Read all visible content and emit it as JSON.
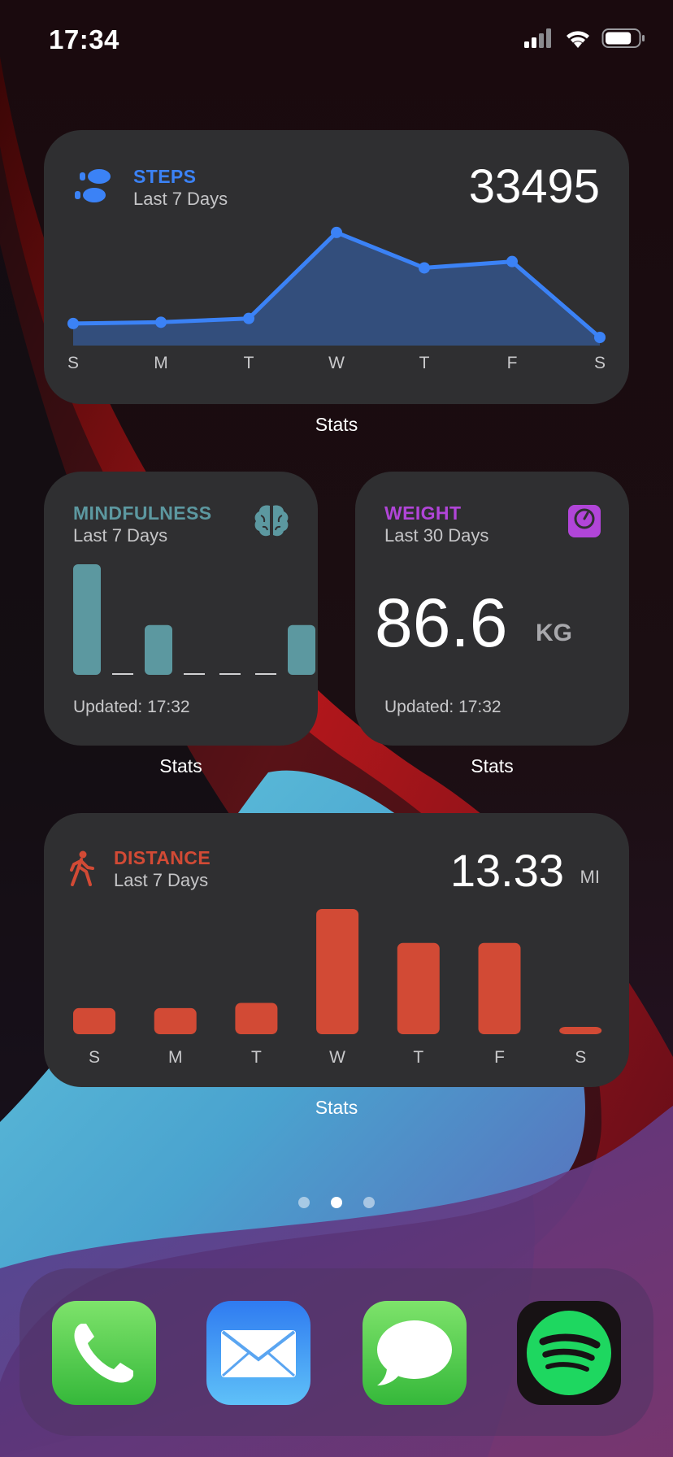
{
  "status_bar": {
    "time": "17:34",
    "battery_level": 0.8,
    "signal_bars": 2,
    "signal_bars_total": 4
  },
  "colors": {
    "steps": "#3b82f6",
    "mindfulness": "#5c98a0",
    "weight": "#b145d8",
    "distance": "#d24a35",
    "widget_bg": "#2f2f31"
  },
  "steps_widget": {
    "title": "STEPS",
    "subtitle": "Last 7 Days",
    "total": "33495",
    "icon": "footprints-icon",
    "label": "Stats",
    "chart_data": {
      "type": "area",
      "categories": [
        "S",
        "M",
        "T",
        "W",
        "T",
        "F",
        "S"
      ],
      "values": [
        1100,
        1200,
        1500,
        8300,
        5500,
        6000,
        0
      ],
      "ylim": [
        0,
        9000
      ]
    }
  },
  "mindfulness_widget": {
    "title": "MINDFULNESS",
    "subtitle": "Last 7 Days",
    "icon": "brain-icon",
    "updated": "Updated: 17:32",
    "label": "Stats",
    "chart_data": {
      "type": "bar",
      "values": [
        20,
        0,
        9,
        0,
        0,
        0,
        9
      ],
      "ylim": [
        0,
        20
      ]
    }
  },
  "weight_widget": {
    "title": "WEIGHT",
    "subtitle": "Last 30 Days",
    "icon": "scale-icon",
    "value": "86.6",
    "unit": "KG",
    "updated": "Updated: 17:32",
    "label": "Stats"
  },
  "distance_widget": {
    "title": "DISTANCE",
    "subtitle": "Last 7 Days",
    "icon": "walking-person-icon",
    "total": "13.33",
    "unit": "MI",
    "label": "Stats",
    "chart_data": {
      "type": "bar",
      "categories": [
        "S",
        "M",
        "T",
        "W",
        "T",
        "F",
        "S"
      ],
      "values": [
        0.5,
        0.5,
        0.6,
        2.4,
        1.75,
        1.75,
        0.05
      ],
      "ylim": [
        0,
        2.4
      ]
    }
  },
  "page_dots": {
    "count": 3,
    "active": 1
  },
  "dock": {
    "apps": [
      {
        "name": "Phone",
        "icon": "phone-icon"
      },
      {
        "name": "Mail",
        "icon": "mail-icon"
      },
      {
        "name": "Messages",
        "icon": "messages-icon"
      },
      {
        "name": "Spotify",
        "icon": "spotify-icon"
      }
    ]
  }
}
